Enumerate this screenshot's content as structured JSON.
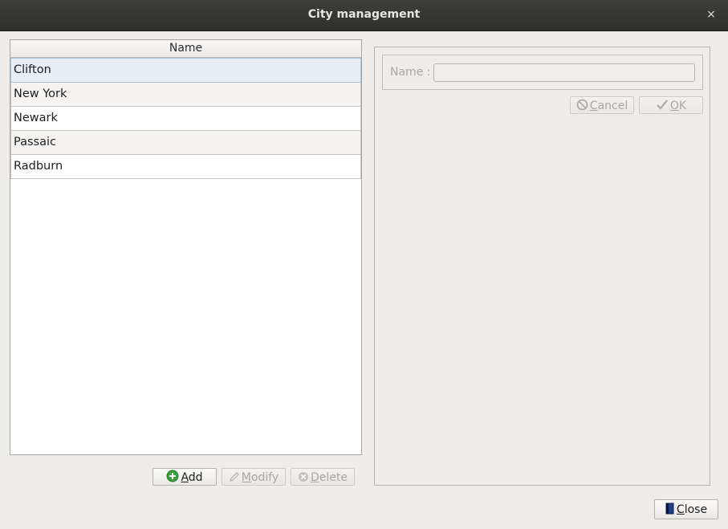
{
  "window": {
    "title": "City management",
    "close_glyph": "×"
  },
  "list": {
    "header": "Name",
    "rows": [
      "Clifton",
      "New York",
      "Newark",
      "Passaic",
      "Radburn"
    ],
    "selected_index": 0
  },
  "list_buttons": {
    "add_label_first": "A",
    "add_label_rest": "dd",
    "modify_label_first": "M",
    "modify_label_rest": "odify",
    "delete_label_first": "D",
    "delete_label_rest": "elete"
  },
  "form": {
    "name_label": "Name :",
    "name_value": "",
    "cancel_label_first": "C",
    "cancel_label_rest": "ancel",
    "ok_label_first": "O",
    "ok_label_rest": "K"
  },
  "footer": {
    "close_label_first": "C",
    "close_label_rest": "lose"
  },
  "colors": {
    "add_icon": "#3aa23a",
    "disabled_text": "#a9a7a3",
    "selection": "#e6eef6"
  },
  "icons": {
    "add": "plus-circle-icon",
    "modify": "pencil-icon",
    "delete": "x-circle-icon",
    "cancel": "no-entry-icon",
    "ok": "checkmark-icon",
    "close": "door-exit-icon"
  }
}
